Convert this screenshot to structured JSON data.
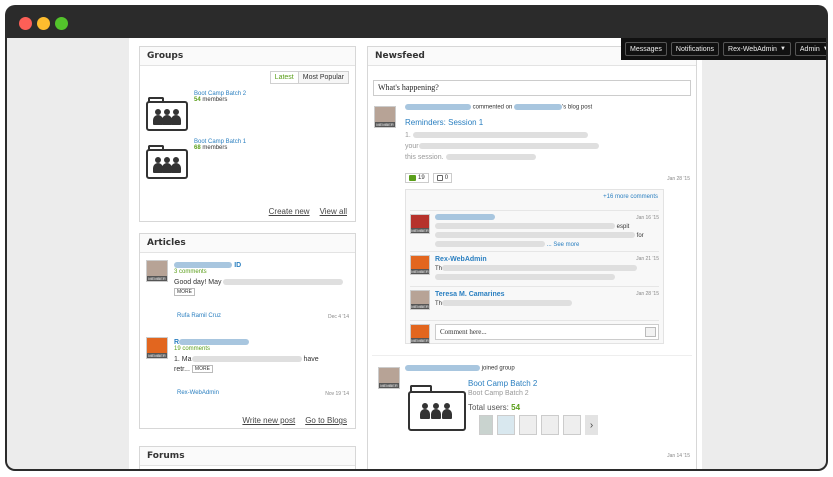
{
  "topbar": {
    "messages": "Messages",
    "notifications": "Notifications",
    "user_menu": "Rex-WebAdmin",
    "admin_menu": "Admin"
  },
  "groups_panel": {
    "title": "Groups",
    "tab_latest": "Latest",
    "tab_popular": "Most Popular",
    "items": [
      {
        "name": "Boot Camp Batch 2",
        "count": "54",
        "suffix": "members"
      },
      {
        "name": "Boot Camp Batch 1",
        "count": "68",
        "suffix": "members"
      }
    ],
    "create_new": "Create new",
    "view_all": "View all"
  },
  "articles_panel": {
    "title": "Articles",
    "items": [
      {
        "title_tail": "ID",
        "comments": "3 comments",
        "excerpt_start": "Good day! May",
        "more": "MORE",
        "author": "Rufa Ramil Cruz",
        "date": "Dec 4 '14"
      },
      {
        "title_start": "R",
        "comments": "19 comments",
        "excerpt_start": "1. Ma",
        "excerpt_end": "have",
        "excerpt_line2": "retr...",
        "more": "MORE",
        "author": "Rex-WebAdmin",
        "date": "Nov 19 '14"
      }
    ],
    "write_new": "Write new post",
    "go_to_blogs": "Go to Blogs"
  },
  "forums_panel": {
    "title": "Forums"
  },
  "newsfeed": {
    "title": "Newsfeed",
    "status_placeholder": "What's happening?",
    "post1": {
      "action": "commented on",
      "object": "'s blog post",
      "title": "Reminders: Session 1",
      "line1_start": "1.",
      "line2_start": "your",
      "line3_start": "this",
      "line3_end": "session.",
      "date": "Jan 28 '15",
      "comment_count": "19",
      "like_count": "0",
      "more_comments": "+16 more comments",
      "comments": [
        {
          "date": "Jan 16 '15",
          "tail1": "espit",
          "tail2": "for",
          "see_more": "... See more"
        },
        {
          "name": "Rex-WebAdmin",
          "date": "Jan 21 '15",
          "line_start": "Th"
        },
        {
          "name": "Teresa M. Camarines",
          "date": "Jan 28 '15",
          "line_start": "Th"
        }
      ],
      "comment_placeholder": "Comment here..."
    },
    "post2": {
      "action": "joined group",
      "group_title": "Boot Camp Batch 2",
      "group_sub": "Boot Camp Batch 2",
      "total_label": "Total users:",
      "total_count": "54",
      "date": "Jan 14 '15"
    }
  },
  "member_badge": "MEMBER",
  "colors": {
    "link": "#2a7fc0",
    "accent_green": "#5a9e1a",
    "topbar": "#111111"
  }
}
